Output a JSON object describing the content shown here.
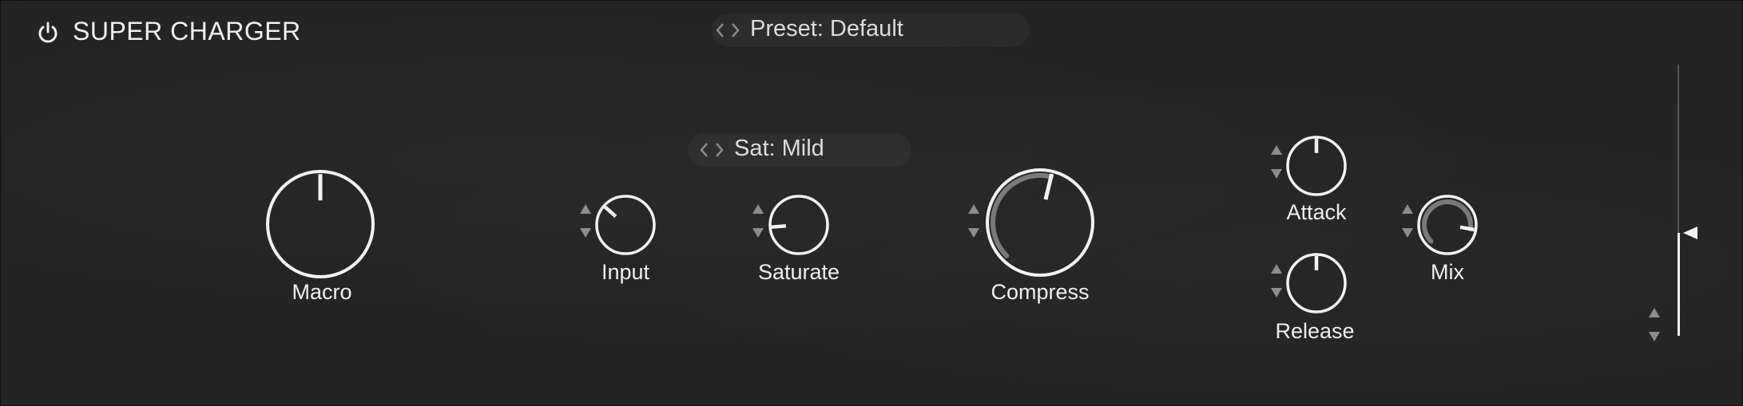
{
  "header": {
    "title": "SUPER CHARGER",
    "power_icon": "power-icon"
  },
  "preset": {
    "label": "Preset: Default",
    "prev_next_icon": "chevron-left-right-icon"
  },
  "saturation_mode": {
    "label": "Sat: Mild",
    "prev_next_icon": "chevron-left-right-icon"
  },
  "knobs": {
    "macro": {
      "label": "Macro",
      "value": 0.5
    },
    "input": {
      "label": "Input",
      "value": 0.32
    },
    "saturate": {
      "label": "Saturate",
      "value": 0.15
    },
    "compress": {
      "label": "Compress",
      "value": 0.55
    },
    "attack": {
      "label": "Attack",
      "value": 0.5
    },
    "release": {
      "label": "Release",
      "value": 0.5
    },
    "mix": {
      "label": "Mix",
      "value": 0.87
    }
  },
  "output_meter": {
    "level": 0.38,
    "icons": [
      "level-pointer-icon",
      "stepper-icon"
    ]
  },
  "colors": {
    "background": "#232323",
    "knob_stroke": "#f2f2f2",
    "arc_accent": "#7a7a7a",
    "stepper": "#8c8c8c"
  }
}
